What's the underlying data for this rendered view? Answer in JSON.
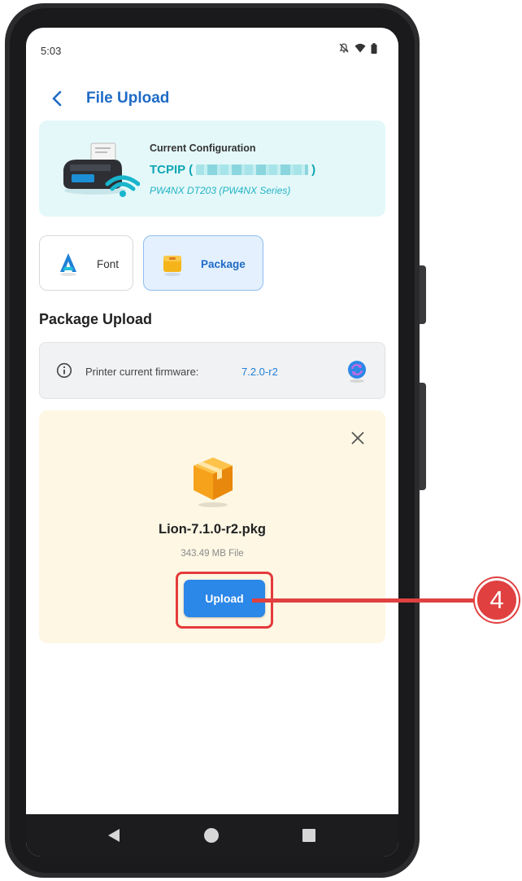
{
  "status_bar": {
    "time": "5:03"
  },
  "header": {
    "title": "File Upload"
  },
  "config": {
    "label": "Current Configuration",
    "connection_prefix": "TCPIP (",
    "connection_suffix": ")",
    "model": "PW4NX DT203 (PW4NX Series)"
  },
  "tabs": [
    {
      "label": "Font",
      "selected": false
    },
    {
      "label": "Package",
      "selected": true
    }
  ],
  "section": {
    "title": "Package Upload"
  },
  "firmware": {
    "label": "Printer current firmware:",
    "value": "7.2.0-r2"
  },
  "upload": {
    "file_name": "Lion-7.1.0-r2.pkg",
    "file_size": "343.49 MB File",
    "button_label": "Upload"
  },
  "callout": {
    "number": "4"
  },
  "colors": {
    "accent": "#1f6bc6",
    "teal": "#0ea5b5",
    "upload_button": "#2b87e8",
    "callout_red": "#e04040"
  }
}
